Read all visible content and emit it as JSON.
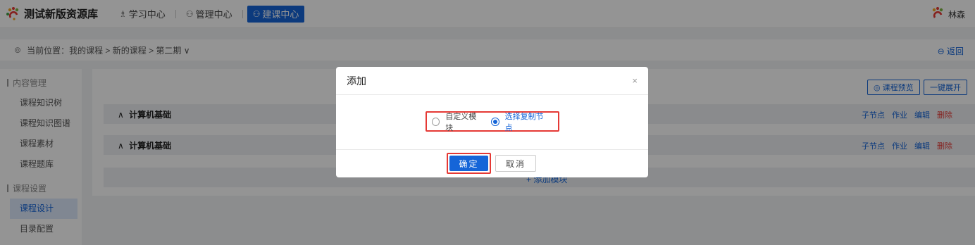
{
  "header": {
    "app_title": "测试新版资源库",
    "nav": [
      {
        "label": "学习中心",
        "icon": "grad-icon"
      },
      {
        "label": "管理中心",
        "icon": "people-icon"
      },
      {
        "label": "建课中心",
        "icon": "build-icon",
        "active": true
      }
    ],
    "user_name": "林森"
  },
  "breadcrumb": {
    "text": "当前位置：我的课程 > 新的课程 > 第二期 ∨",
    "back_label": "返回"
  },
  "sidebar": {
    "groups": [
      {
        "label": "内容管理",
        "items": [
          "课程知识树",
          "课程知识图谱",
          "课程素材",
          "课程题库"
        ]
      },
      {
        "label": "课程设置",
        "items": [
          "课程设计",
          "目录配置"
        ]
      }
    ],
    "active_item": "课程设计"
  },
  "main": {
    "preview_label": "课程预览",
    "expand_label": "一键展开",
    "nodes": [
      {
        "title": "计算机基础",
        "caret": "∧"
      },
      {
        "title": "计算机基础",
        "caret": "∧"
      }
    ],
    "node_actions": {
      "child": "子节点",
      "homework": "作业",
      "edit": "编辑",
      "delete": "删除"
    },
    "add_text": "+ 添加模块"
  },
  "dialog": {
    "title": "添加",
    "close": "×",
    "options": [
      {
        "label": "自定义模块",
        "checked": false
      },
      {
        "label": "选择复制节点",
        "checked": true
      }
    ],
    "ok_label": "确定",
    "cancel_label": "取消"
  },
  "colors": {
    "accent": "#1565d8",
    "danger": "#e53935",
    "highlight_border": "#e53935"
  }
}
